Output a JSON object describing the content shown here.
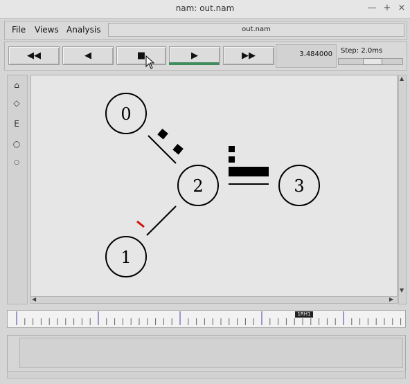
{
  "window": {
    "title": "nam: out.nam",
    "controls": [
      "—",
      "+",
      "×"
    ]
  },
  "menu": {
    "items": [
      {
        "label": "File"
      },
      {
        "label": "Views"
      },
      {
        "label": "Analysis"
      }
    ],
    "filename": "out.nam"
  },
  "playback": {
    "rewind_fast": "◀◀",
    "back": "◀",
    "stop": "■",
    "play": "▶",
    "forward_fast": "▶▶",
    "time": "3.484000",
    "step_label": "Step: 2.0ms"
  },
  "tools": [
    {
      "icon": "zoom-in-icon",
      "glyph": "⌂"
    },
    {
      "icon": "zoom-out-icon",
      "glyph": "◇"
    },
    {
      "icon": "edit-icon",
      "glyph": "E"
    },
    {
      "icon": "circle-icon",
      "glyph": "○"
    },
    {
      "icon": "small-circle-icon",
      "glyph": "○"
    }
  ],
  "network": {
    "nodes": [
      {
        "label": "0"
      },
      {
        "label": "1"
      },
      {
        "label": "2"
      },
      {
        "label": "3"
      }
    ],
    "colors": {
      "packet": "#000000",
      "dropped_packet": "#d01010",
      "link": "#000000"
    }
  },
  "timeline": {
    "marker_label": "1RH1"
  }
}
